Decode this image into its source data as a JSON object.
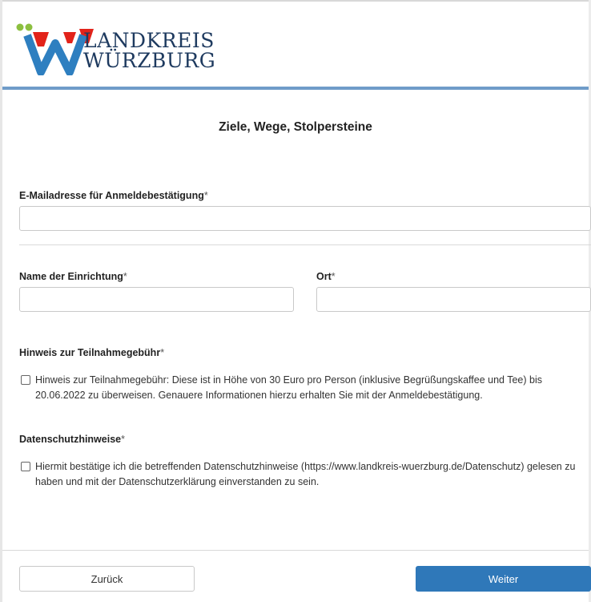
{
  "brand": {
    "line1": "LANDKREIS",
    "line2": "WÜRZBURG",
    "colors": {
      "red": "#e2231a",
      "blue": "#2e7fc0",
      "green": "#8cbf3f",
      "navy": "#1e3a5f"
    }
  },
  "form": {
    "title": "Ziele, Wege, Stolpersteine",
    "email": {
      "label": "E-Mailadresse für Anmeldebestätigung",
      "value": "",
      "placeholder": ""
    },
    "institution": {
      "label": "Name der Einrichtung",
      "value": "",
      "placeholder": ""
    },
    "place": {
      "label": "Ort",
      "value": "",
      "placeholder": ""
    },
    "required_mark": "*",
    "fee": {
      "heading": "Hinweis zur Teilnahmegebühr",
      "text": "Hinweis zur Teilnahmegebühr: Diese ist in Höhe von 30 Euro pro Person (inklusive Begrüßungskaffee und Tee) bis 20.06.2022 zu überweisen. Genauere Informationen hierzu erhalten Sie mit der Anmeldebestätigung.",
      "checked": false
    },
    "privacy": {
      "heading": "Datenschutzhinweise",
      "text": "Hiermit bestätige ich die betreffenden Datenschutzhinweise (https://www.landkreis-wuerzburg.de/Datenschutz) gelesen zu haben und mit der Datenschutzerklärung einverstanden zu sein.",
      "checked": false
    }
  },
  "buttons": {
    "back": "Zurück",
    "next": "Weiter"
  }
}
